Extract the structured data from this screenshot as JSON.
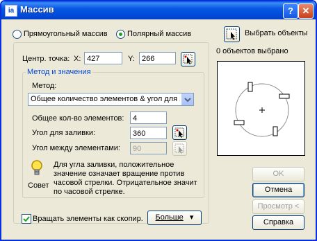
{
  "window": {
    "title": "Массив",
    "help_label": "?",
    "close_label": "✕"
  },
  "mode": {
    "rectangular_label": "Прямоугольный массив",
    "polar_label": "Полярный массив",
    "selected": "polar"
  },
  "select_objects": {
    "label": "Выбрать объекты",
    "status": "0 объектов выбрано"
  },
  "center": {
    "label": "Центр. точка:",
    "x_label": "X:",
    "x_value": "427",
    "y_label": "Y:",
    "y_value": "266"
  },
  "method_group": {
    "title": "Метод и значения",
    "method_label": "Метод:",
    "method_value": "Общее количество элементов & угол для заливки",
    "total_items_label": "Общее кол-во элементов:",
    "total_items_value": "4",
    "fill_angle_label": "Угол для заливки:",
    "fill_angle_value": "360",
    "between_angle_label": "Угол между элементами:",
    "between_angle_value": "90"
  },
  "tip": {
    "label": "Совет",
    "text": "Для угла заливки, положительное значение означает вращение против часовой стрелки. Отрицательное значит по часовой стрелке."
  },
  "rotate": {
    "label": "Вращать элементы как скопир.",
    "checked": true
  },
  "buttons": {
    "more": "Больше",
    "ok": "OK",
    "cancel": "Отмена",
    "preview": "Просмотр <",
    "help": "Справка"
  }
}
